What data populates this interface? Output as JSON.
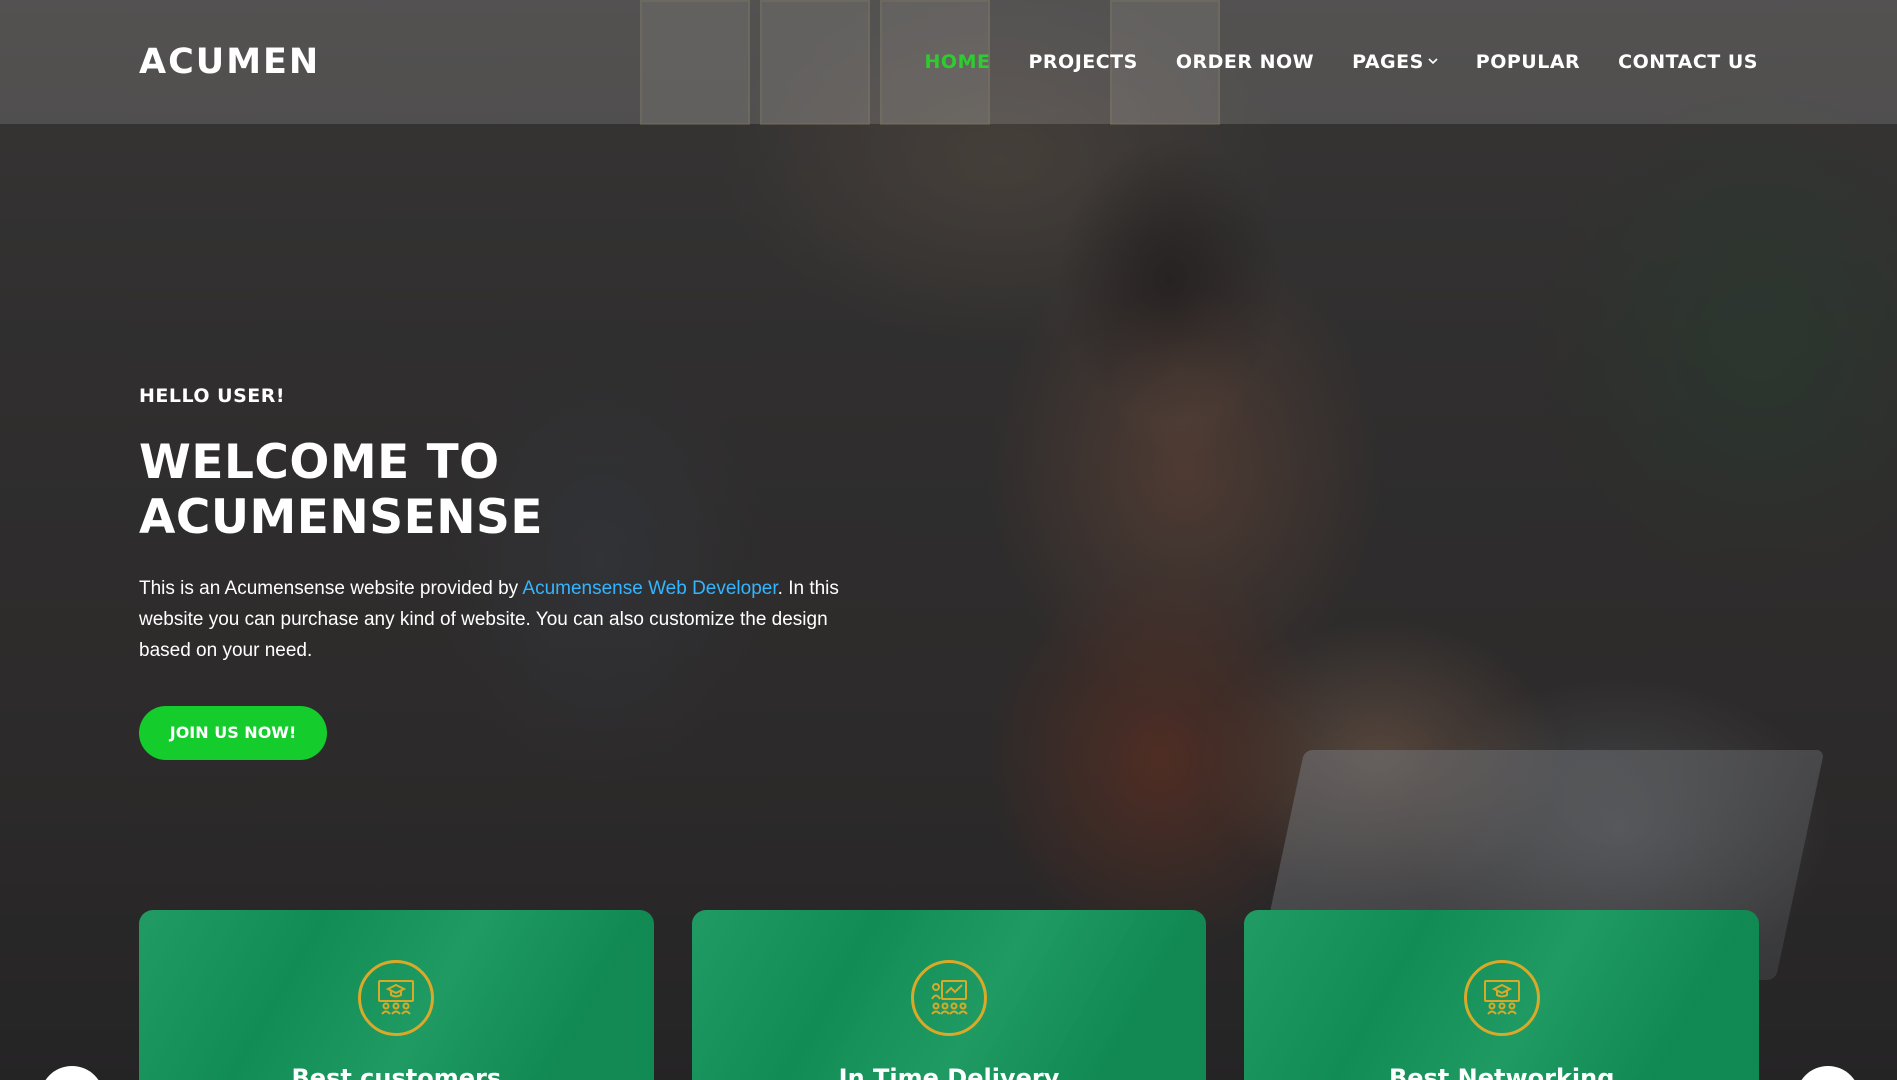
{
  "brand": "ACUMEN",
  "nav": {
    "home": "HOME",
    "projects": "PROJECTS",
    "order_now": "ORDER NOW",
    "pages": "PAGES",
    "popular": "POPULAR",
    "contact_us": "CONTACT US"
  },
  "hero": {
    "greeting": "HELLO USER!",
    "headline": "WELCOME TO ACUMENSENSE",
    "desc_before": "This is an Acumensense website provided by ",
    "desc_link": "Acumensense Web Developer",
    "desc_after": ". In this website you can purchase any kind of website. You can also customize the design based on your need.",
    "cta": "JOIN US NOW!"
  },
  "cards": [
    {
      "title": "Best customers",
      "icon": "teacher-classroom-icon"
    },
    {
      "title": "In Time Delivery",
      "icon": "presentation-team-icon"
    },
    {
      "title": "Best Networking",
      "icon": "teacher-classroom-icon"
    }
  ],
  "colors": {
    "accent_green": "#14cc2c",
    "active_nav": "#2ecc2e",
    "link_blue": "#33b5ff",
    "card_green": "#13955a",
    "icon_gold": "#d9a929"
  }
}
